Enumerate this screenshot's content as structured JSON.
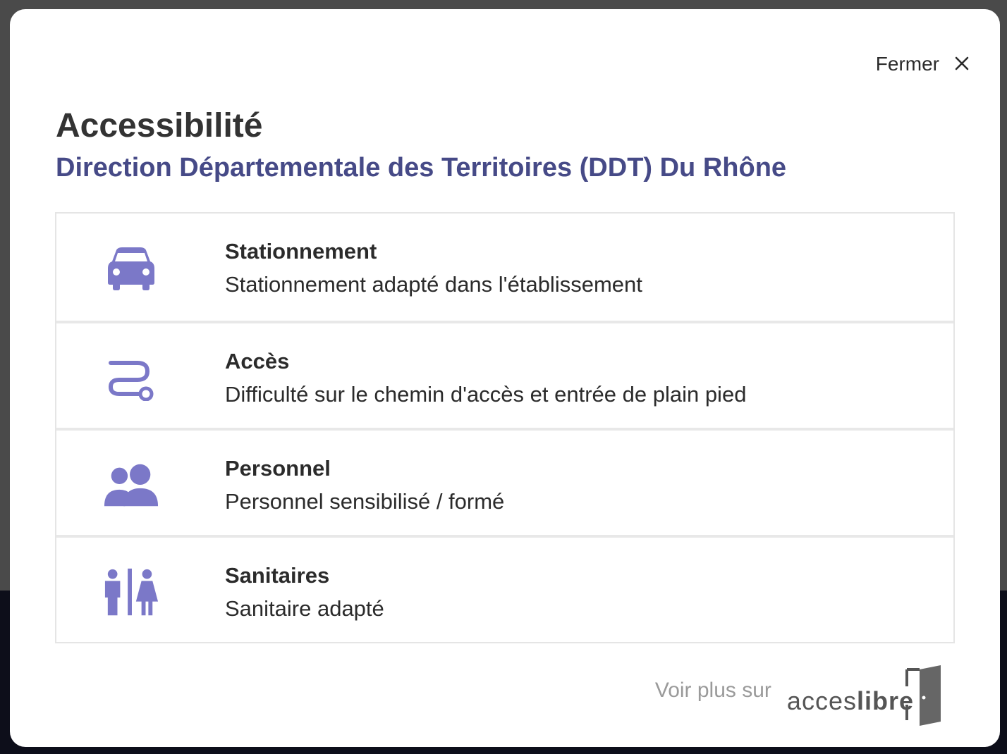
{
  "modal": {
    "close_label": "Fermer",
    "title": "Accessibilité",
    "subtitle": "Direction Départementale des Territoires (DDT) Du Rhône",
    "icon_color": "#7b78c8",
    "items": [
      {
        "icon": "car-icon",
        "name": "Stationnement",
        "description": "Stationnement adapté dans l'établissement"
      },
      {
        "icon": "path-icon",
        "name": "Accès",
        "description": "Difficulté sur le chemin d'accès et entrée de plain pied"
      },
      {
        "icon": "people-icon",
        "name": "Personnel",
        "description": "Personnel sensibilisé / formé"
      },
      {
        "icon": "restroom-icon",
        "name": "Sanitaires",
        "description": "Sanitaire adapté"
      }
    ],
    "footer": {
      "voir_label": "Voir plus sur",
      "brand_part1": "acces",
      "brand_part2": "libre"
    }
  }
}
